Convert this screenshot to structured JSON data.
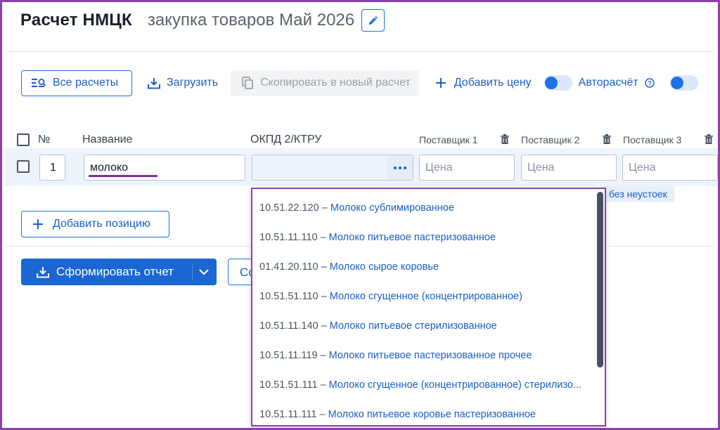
{
  "header": {
    "title": "Расчет НМЦК",
    "subtitle": "закупка товаров Май 2026"
  },
  "toolbar": {
    "all_calcs": "Все расчеты",
    "upload": "Загрузить",
    "copy_to_new": "Скопировать в новый расчет",
    "add_price": "Добавить цену",
    "autocalc": "Авторасчёт"
  },
  "table": {
    "headers": {
      "number": "№",
      "name": "Название",
      "okpd": "ОКПД 2/КТРУ",
      "supplier1": "Поставщик 1",
      "supplier2": "Поставщик 2",
      "supplier3": "Поставщик 3"
    },
    "row": {
      "number": "1",
      "name": "молоко",
      "okpd_value": "",
      "price_placeholder": "Цена"
    },
    "hint_text": "без неустоек"
  },
  "add_position": "Добавить позицию",
  "report_button": "Сформировать отчет",
  "partial_button": "Со",
  "dropdown": {
    "separator": "–",
    "items": [
      {
        "code": "10.51.22.120",
        "label": "Молоко сублимированное"
      },
      {
        "code": "10.51.11.110",
        "label": "Молоко питьевое пастеризованное"
      },
      {
        "code": "01.41.20.110",
        "label": "Молоко сырое коровье"
      },
      {
        "code": "10.51.51.110",
        "label": "Молоко сгущенное (концентрированное)"
      },
      {
        "code": "10.51.11.140",
        "label": "Молоко питьевое стерилизованное"
      },
      {
        "code": "10.51.11.119",
        "label": "Молоко питьевое пастеризованное прочее"
      },
      {
        "code": "10.51.51.111",
        "label": "Молоко сгущенное (концентрированное) стерилизо..."
      },
      {
        "code": "10.51.11.111",
        "label": "Молоко питьевое коровье пастеризованное"
      }
    ]
  },
  "colors": {
    "accent": "#1a73e8",
    "highlight": "#8b3fb0"
  }
}
